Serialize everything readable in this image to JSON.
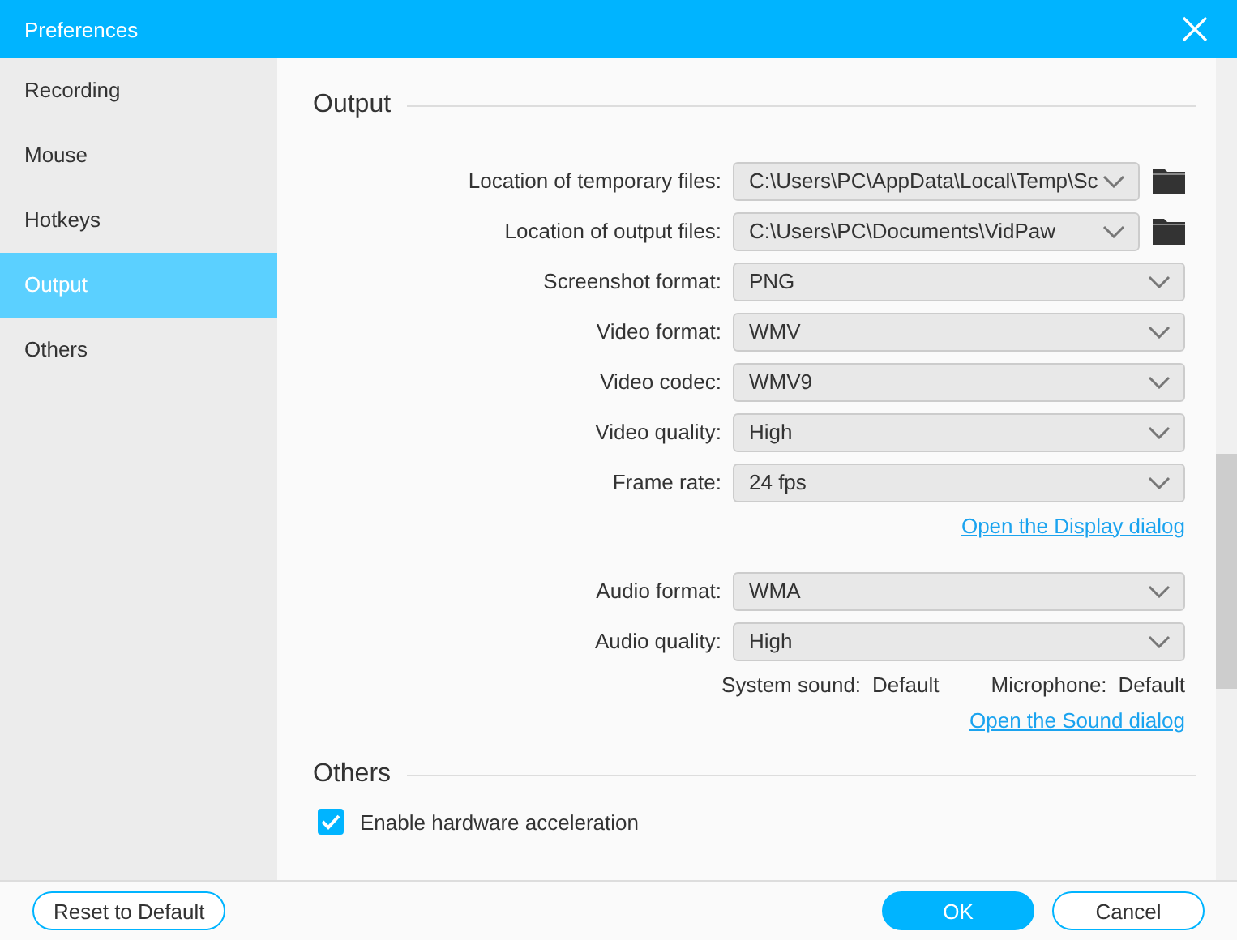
{
  "window": {
    "title": "Preferences"
  },
  "sidebar": {
    "items": [
      {
        "label": "Recording",
        "selected": false
      },
      {
        "label": "Mouse",
        "selected": false
      },
      {
        "label": "Hotkeys",
        "selected": false
      },
      {
        "label": "Output",
        "selected": true
      },
      {
        "label": "Others",
        "selected": false
      }
    ]
  },
  "output": {
    "title": "Output",
    "groups": [
      {
        "fields": [
          {
            "kind": "path",
            "label": "Location of temporary files:",
            "value": "C:\\Users\\PC\\AppData\\Local\\Temp\\Sc"
          },
          {
            "kind": "path",
            "label": "Location of output files:",
            "value": "C:\\Users\\PC\\Documents\\VidPaw"
          },
          {
            "kind": "select",
            "label": "Screenshot format:",
            "value": "PNG"
          },
          {
            "kind": "select",
            "label": "Video format:",
            "value": "WMV"
          },
          {
            "kind": "select",
            "label": "Video codec:",
            "value": "WMV9"
          },
          {
            "kind": "select",
            "label": "Video quality:",
            "value": "High"
          },
          {
            "kind": "select",
            "label": "Frame rate:",
            "value": "24 fps"
          }
        ],
        "link": "Open the Display dialog"
      },
      {
        "fields": [
          {
            "kind": "select",
            "label": "Audio format:",
            "value": "WMA"
          },
          {
            "kind": "select",
            "label": "Audio quality:",
            "value": "High"
          }
        ],
        "info": [
          {
            "label": "System sound:",
            "value": "Default"
          },
          {
            "label": "Microphone:",
            "value": "Default"
          }
        ],
        "link": "Open the Sound dialog"
      }
    ]
  },
  "others": {
    "title": "Others",
    "checkboxes": [
      {
        "label": "Enable hardware acceleration",
        "checked": true
      }
    ]
  },
  "footer": {
    "buttons": [
      {
        "label": "Reset to Default",
        "kind": "secondary"
      },
      {
        "label": "OK",
        "kind": "primary"
      },
      {
        "label": "Cancel",
        "kind": "secondary"
      }
    ]
  }
}
